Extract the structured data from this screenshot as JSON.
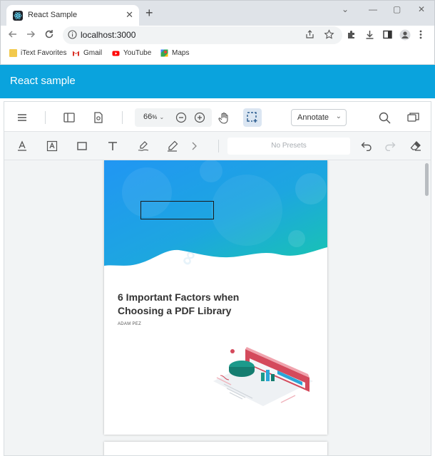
{
  "browser": {
    "tab_title": "React Sample",
    "tab_close": "✕",
    "new_tab": "+",
    "url": "localhost:3000",
    "window_controls": [
      "⌄",
      "—",
      "▢",
      "✕"
    ],
    "bookmarks": [
      {
        "label": "iText Favorites",
        "icon": "folder-icon",
        "color": "#f2c94c"
      },
      {
        "label": "Gmail",
        "icon": "gmail-icon",
        "color": "#d93025"
      },
      {
        "label": "YouTube",
        "icon": "youtube-icon",
        "color": "#ff0000"
      },
      {
        "label": "Maps",
        "icon": "maps-icon",
        "color": "#34a853"
      }
    ]
  },
  "app": {
    "title": "React sample",
    "header_color": "#0aa3dd"
  },
  "viewer": {
    "zoom": "66",
    "zoom_unit": "%",
    "annotate_label": "Annotate",
    "presets_placeholder": "No Presets"
  },
  "document": {
    "title": "6 Important Factors when Choosing a PDF Library",
    "author": "ADAM PEZ"
  }
}
